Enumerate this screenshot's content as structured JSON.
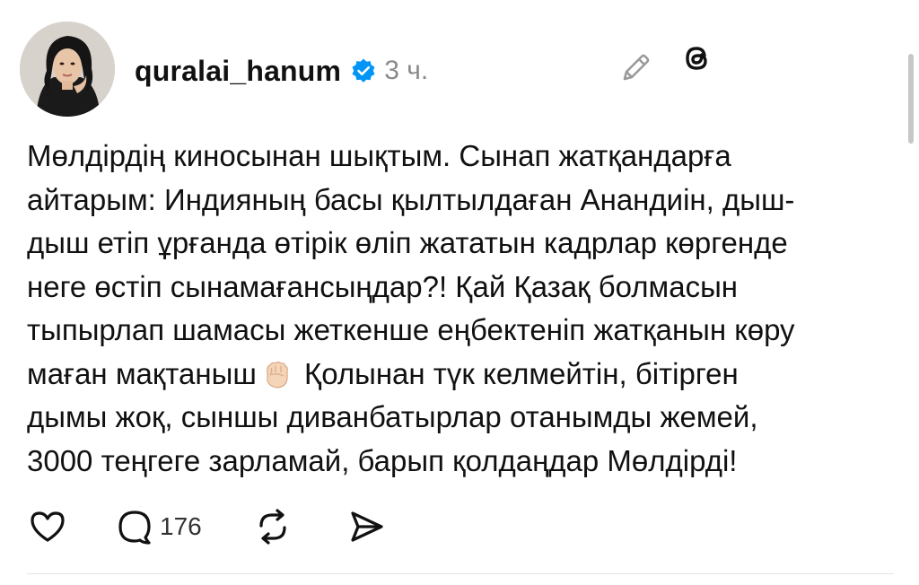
{
  "post": {
    "username": "quralai_hanum",
    "time": "3 ч.",
    "body_lines": [
      "Мөлдірдің киносынан шықтым. Сынап жатқандарға",
      "айтарым: Индияның басы қылтылдаған Анандиін, дыш-",
      "дыш етіп ұрғанда өтірік өліп жататын кадрлар көргенде",
      "неге өстіп сынамағансыңдар?! Қай Қазақ болмасын",
      "тыпырлап шамасы жеткенше еңбектеніп жатқанын көру"
    ],
    "line6_before_emoji": "маған мақтаныш",
    "line6_after_emoji": " Қолынан түк келмейтін, бітірген",
    "body_lines_end": [
      "дымы жоқ, сыншы диванбатырлар отанымды жемей,",
      "3000 теңгеге зарламай, барып қолдаңдар Мөлдірді!"
    ],
    "reply_count": "176"
  },
  "icons": {
    "verified": "verified-badge-icon",
    "edit": "pencil-icon",
    "threads": "threads-logo-icon",
    "emoji": "raised-fist-emoji",
    "like": "heart-icon",
    "reply": "comment-bubble-icon",
    "repost": "repost-icon",
    "share": "send-icon"
  },
  "colors": {
    "verified_blue": "#0095f6",
    "text": "#111111",
    "muted": "#8a8a8a"
  }
}
